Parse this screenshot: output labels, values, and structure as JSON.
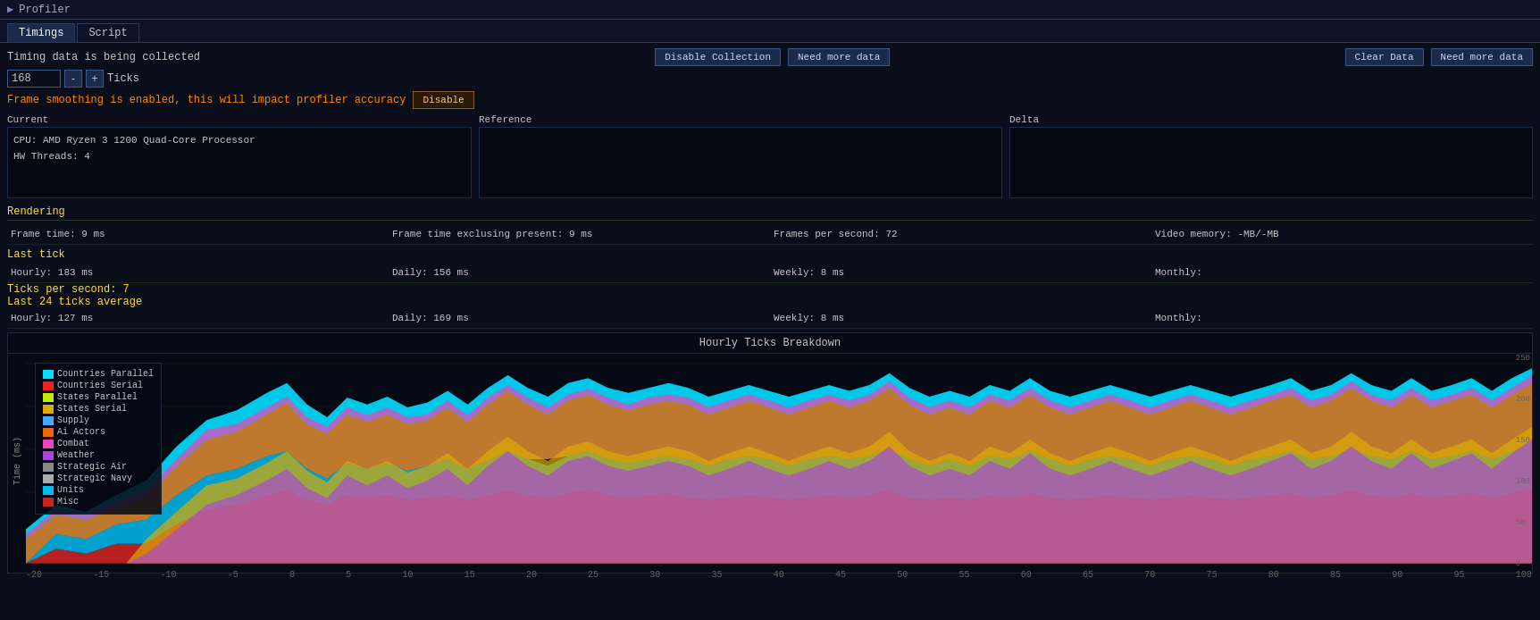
{
  "titleBar": {
    "title": "Profiler",
    "icon": "▶"
  },
  "tabs": [
    {
      "label": "Timings",
      "active": true
    },
    {
      "label": "Script",
      "active": false
    }
  ],
  "topSection": {
    "statusText": "Timing data is being collected",
    "ticksValue": "168",
    "ticksLabel": "Ticks",
    "decrementLabel": "-",
    "incrementLabel": "+",
    "disableCollectionLabel": "Disable Collection",
    "needMoreDataLabel1": "Need more data",
    "clearDataLabel": "Clear Data",
    "needMoreDataLabel2": "Need more data",
    "warningText": "Frame smoothing is enabled, this will impact profiler accuracy",
    "disableLabel": "Disable"
  },
  "panels": {
    "currentLabel": "Current",
    "referenceLabel": "Reference",
    "deltaLabel": "Delta",
    "currentContent": {
      "line1": "CPU: AMD Ryzen 3 1200 Quad-Core Processor",
      "line2": "HW Threads: 4"
    }
  },
  "rendering": {
    "header": "Rendering",
    "frameTime": "Frame time: 9 ms",
    "frameTimeExcluding": "Frame time exclusing present: 9 ms",
    "framesPerSecond": "Frames per second: 72",
    "videoMemory": "Video memory: -MB/-MB"
  },
  "lastTick": {
    "header": "Last tick",
    "hourly": "Hourly: 183 ms",
    "daily": "Daily: 156 ms",
    "weekly": "Weekly: 8 ms",
    "monthly": "Monthly:"
  },
  "ticksPerSec": {
    "label": "Ticks per second: 7"
  },
  "last24": {
    "header": "Last 24 ticks average",
    "hourly": "Hourly: 127 ms",
    "daily": "Daily: 169 ms",
    "weekly": "Weekly: 8 ms",
    "monthly": "Monthly:"
  },
  "chart": {
    "title": "Hourly Ticks Breakdown",
    "yLabel": "Time (ms)",
    "yAxisLabels": [
      "250",
      "200",
      "150",
      "100",
      "50",
      "0"
    ],
    "xAxisLabels": [
      "-20",
      "-15",
      "-10",
      "-5",
      "0",
      "5",
      "10",
      "15",
      "20",
      "25",
      "30",
      "35",
      "40",
      "45",
      "50",
      "55",
      "60",
      "65",
      "70",
      "75",
      "80",
      "85",
      "90",
      "95",
      "100"
    ]
  },
  "legend": {
    "items": [
      {
        "label": "Countries Parallel",
        "color": "#00ddff"
      },
      {
        "label": "Countries Serial",
        "color": "#ee2222"
      },
      {
        "label": "States Parallel",
        "color": "#bbee00"
      },
      {
        "label": "States Serial",
        "color": "#ddaa00"
      },
      {
        "label": "Supply",
        "color": "#44aaff"
      },
      {
        "label": "Ai Actors",
        "color": "#ee6600"
      },
      {
        "label": "Combat",
        "color": "#ee44bb"
      },
      {
        "label": "Weather",
        "color": "#aa44dd"
      },
      {
        "label": "Strategic Air",
        "color": "#888888"
      },
      {
        "label": "Strategic Navy",
        "color": "#aaaaaa"
      },
      {
        "label": "Units",
        "color": "#00bbee"
      },
      {
        "label": "Misc",
        "color": "#cc2222"
      }
    ]
  },
  "colors": {
    "accent": "#ffdd44",
    "warning": "#ff8800",
    "background": "#0a0e1a",
    "panelBg": "#050810",
    "border": "#1a2a4a"
  }
}
